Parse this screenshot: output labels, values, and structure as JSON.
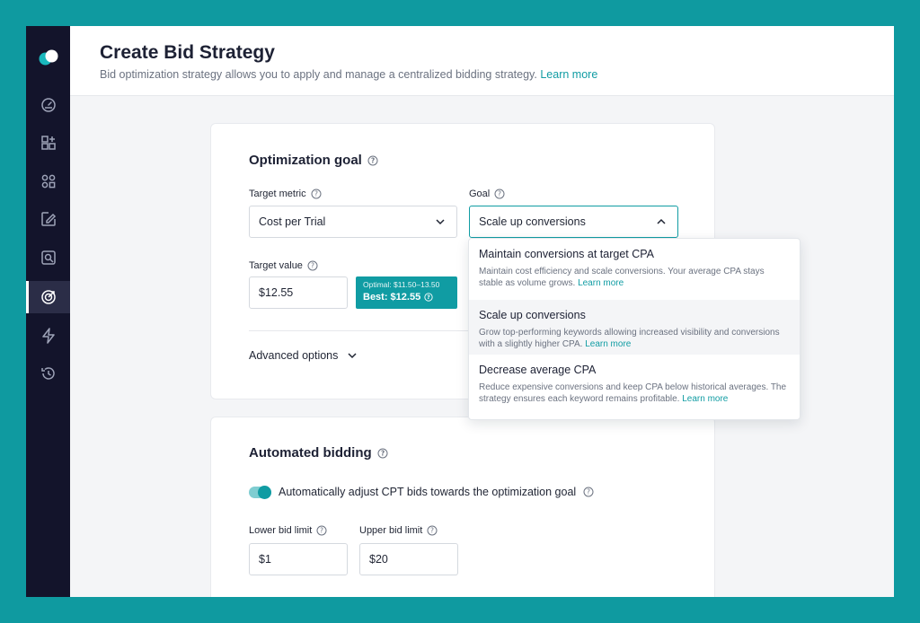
{
  "header": {
    "title": "Create Bid Strategy",
    "subtitle": "Bid optimization strategy allows you to apply and manage a centralized bidding strategy.",
    "learn_more": "Learn more"
  },
  "sidebar": {
    "items": [
      {
        "icon": "dashboard-icon"
      },
      {
        "icon": "add-widget-icon"
      },
      {
        "icon": "grid-icon"
      },
      {
        "icon": "edit-image-icon"
      },
      {
        "icon": "search-icon"
      },
      {
        "icon": "target-icon",
        "active": true
      },
      {
        "icon": "lightning-icon"
      },
      {
        "icon": "history-icon"
      }
    ]
  },
  "optimization": {
    "title": "Optimization goal",
    "target_metric_label": "Target metric",
    "target_metric_value": "Cost per Trial",
    "goal_label": "Goal",
    "goal_value": "Scale up conversions",
    "target_value_label": "Target value",
    "target_value": "$12.55",
    "optimal_range": "Optimal: $11.50–13.50",
    "best": "Best: $12.55",
    "advanced_options": "Advanced options"
  },
  "goal_options": [
    {
      "title": "Maintain conversions at target CPA",
      "desc": "Maintain cost efficiency and scale conversions. Your average CPA stays stable as volume grows.",
      "link": "Learn more"
    },
    {
      "title": "Scale up conversions",
      "desc": "Grow top-performing keywords allowing increased visibility and conversions with a slightly higher CPA.",
      "link": "Learn more",
      "selected": true
    },
    {
      "title": "Decrease average CPA",
      "desc": "Reduce expensive conversions and keep CPA below historical averages. The strategy ensures each keyword remains profitable.",
      "link": "Learn more"
    }
  ],
  "automated": {
    "title": "Automated bidding",
    "toggle_label": "Automatically adjust CPT bids towards the optimization goal",
    "toggle_on": true,
    "lower_label": "Lower bid limit",
    "lower_value": "$1",
    "upper_label": "Upper bid limit",
    "upper_value": "$20"
  },
  "colors": {
    "accent": "#109ca3",
    "sidebar": "#13142b",
    "background": "#0f9aa0"
  }
}
